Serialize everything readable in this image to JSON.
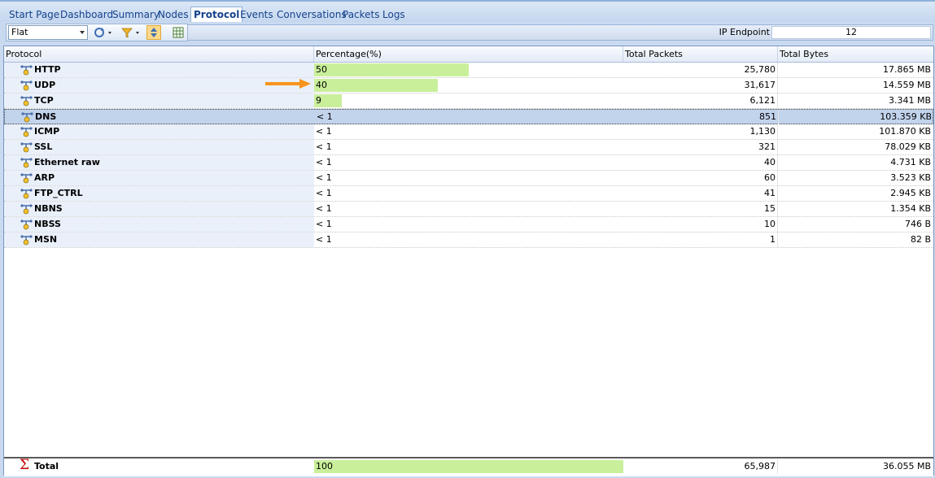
{
  "tabs": [
    {
      "label": "Start Page",
      "active": false
    },
    {
      "label": "Dashboard",
      "active": false
    },
    {
      "label": "Summary",
      "active": false
    },
    {
      "label": "Nodes",
      "active": false
    },
    {
      "label": "Protocol",
      "active": true
    },
    {
      "label": "Events",
      "active": false
    },
    {
      "label": "Conversations",
      "active": false
    },
    {
      "label": "Packets",
      "active": false
    },
    {
      "label": "Logs",
      "active": false
    }
  ],
  "toolbar": {
    "view_mode": "Flat",
    "endpoint_label": "IP Endpoint",
    "endpoint_value": "12",
    "icons": [
      "refresh-icon",
      "filter-icon",
      "sort-icon",
      "spreadsheet-icon"
    ]
  },
  "table": {
    "columns": [
      "Protocol",
      "Percentage(%)",
      "Total Packets",
      "Total Bytes"
    ],
    "rows": [
      {
        "protocol": "HTTP",
        "percentage": "50",
        "pct_value": 50,
        "packets": "25,780",
        "bytes": "17.865 MB"
      },
      {
        "protocol": "UDP",
        "percentage": "40",
        "pct_value": 40,
        "packets": "31,617",
        "bytes": "14.559 MB"
      },
      {
        "protocol": "TCP",
        "percentage": "9",
        "pct_value": 9,
        "packets": "6,121",
        "bytes": "3.341 MB"
      },
      {
        "protocol": "DNS",
        "percentage": "< 1",
        "pct_value": 0,
        "packets": "851",
        "bytes": "103.359 KB",
        "selected": true
      },
      {
        "protocol": "ICMP",
        "percentage": "< 1",
        "pct_value": 0,
        "packets": "1,130",
        "bytes": "101.870 KB"
      },
      {
        "protocol": "SSL",
        "percentage": "< 1",
        "pct_value": 0,
        "packets": "321",
        "bytes": "78.029 KB"
      },
      {
        "protocol": "Ethernet raw",
        "percentage": "< 1",
        "pct_value": 0,
        "packets": "40",
        "bytes": "4.731 KB"
      },
      {
        "protocol": "ARP",
        "percentage": "< 1",
        "pct_value": 0,
        "packets": "60",
        "bytes": "3.523 KB"
      },
      {
        "protocol": "FTP_CTRL",
        "percentage": "< 1",
        "pct_value": 0,
        "packets": "41",
        "bytes": "2.945 KB"
      },
      {
        "protocol": "NBNS",
        "percentage": "< 1",
        "pct_value": 0,
        "packets": "15",
        "bytes": "1.354 KB"
      },
      {
        "protocol": "NBSS",
        "percentage": "< 1",
        "pct_value": 0,
        "packets": "10",
        "bytes": "746 B"
      },
      {
        "protocol": "MSN",
        "percentage": "< 1",
        "pct_value": 0,
        "packets": "1",
        "bytes": "82 B"
      }
    ],
    "total": {
      "label": "Total",
      "percentage": "100",
      "pct_value": 100,
      "packets": "65,987",
      "bytes": "36.055 MB"
    }
  },
  "colors": {
    "accent": "#15428b",
    "bar_fill": "#c9ef9a",
    "selected_row": "#c2d3ec",
    "annotation_arrow": "#f7941d",
    "total_sigma": "#c00000"
  }
}
